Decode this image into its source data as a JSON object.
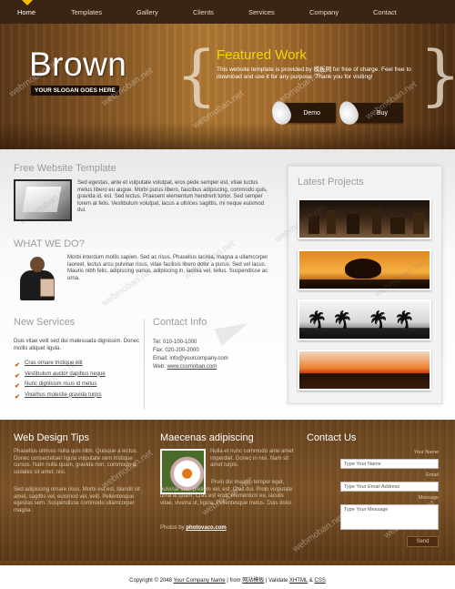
{
  "nav": {
    "items": [
      "Home",
      "Templates",
      "Gallery",
      "Clients",
      "Services",
      "Company",
      "Contact"
    ]
  },
  "hero": {
    "brand": "Brown",
    "slogan": "YOUR SLOGAN GOES HERE",
    "featured_title": "Featured Work",
    "featured_text": "This website template is provided by 模板网 for free of charge. Feel free to download and use it for any purpose. Thank you for visiting!",
    "demo_label": "Demo",
    "buy_label": "Buy"
  },
  "free_template": {
    "heading": "Free Website Template",
    "text": "Sed egestas, ante et vulputate volutpat, eros pede semper est, vitae luctus metus libero eu augue. Morbi purus libero, faucibus adipiscing, commodo quis, gravida id, est. Sed lectus. Praesent elementum hendrerit tortor. Sed semper lorem at felis. Vestibulum volutpat, lacus a ultrices sagittis, mi neque euismod dui."
  },
  "what_we_do": {
    "heading": "WHAT WE DO?",
    "text": "Morbi interdum mollis sapien. Sed ac risus. Phasellus lacinia, magna a ullamcorper laoreet, lectus arcu pulvinar risus, vitae facilisis libero dolor a purus. Sed vel lacus. Mauris nibh felis, adipiscing varius, adipiscing in, lacinia vel, tellus. Suspendisse ac urna."
  },
  "new_services": {
    "heading": "New Services",
    "intro": "Duis vitae velit sed dui malesuada dignissim. Donec mollis aliquet ligula.",
    "items": [
      "Cras ornare tristique elit",
      "Vestibulum auctor dapibus neque",
      "Nunc dignissim risus id metus",
      "Vivamus molestie gravida turpis"
    ]
  },
  "contact_info": {
    "heading": "Contact Info",
    "tel": "Tel: 010-100-1000",
    "fax": "Fax: 020-200-2000",
    "email": "Email: info@yourcompany.com",
    "web_label": "Web: ",
    "web_link": "www.cssmoban.com"
  },
  "latest_projects": {
    "heading": "Latest Projects"
  },
  "web_design_tips": {
    "heading": "Web Design Tips",
    "p1": "Phasellus ultrices nulla quis nibh. Quisque a lectus. Donec consectetuer ligula vulputate sem tristique cursus. Nam nulla quam, gravida non, commodo a, sodales sit amet, nisi.",
    "p2": "Sed adipiscing ornare risus. Morbi est est, blandit sit amet, sagittis vel, euismod vel, velit. Pellentesque egestas sem. Suspendisse commodo ullamcorper magna."
  },
  "maecenas": {
    "heading": "Maecenas adipiscing",
    "text_side": "Nulla et nunc commodo ante amet imperdiet. Donec in nisi. Nam sit amet turpis.",
    "text_below": "Proin dui mauris, tempor eget, pulvinar sed, pretium vel, est. Cras dui. Proin vulputate urna at quam. Cras est eros, elementum eu, iaculis vitae, viverra ut, ligula. Pellentesque metus. Duis dolor.",
    "credit_label": "Photos by ",
    "credit_link": "photovaco.com"
  },
  "contact_us": {
    "heading": "Contact Us",
    "name_label": "Your Name",
    "name_value": "Type Your Name",
    "email_label": "Email",
    "email_value": "Type Your Email Address",
    "message_label": "Message",
    "message_value": "Type Your Message",
    "send_label": "Send"
  },
  "footer": {
    "copyright": "Copyright © 2048 ",
    "company_link": "Your Company Name",
    "sep1": " | from ",
    "source_link": "网站模板",
    "sep2": " | Validate ",
    "xhtml_link": "XHTML",
    "amp": " & ",
    "css_link": "CSS"
  },
  "watermark": "webmoban.net",
  "colors": {
    "nav_bg": "#3a2414",
    "featured_title": "#f5d800",
    "accent_check": "#c05a10",
    "band_bg": "#7e5428"
  }
}
